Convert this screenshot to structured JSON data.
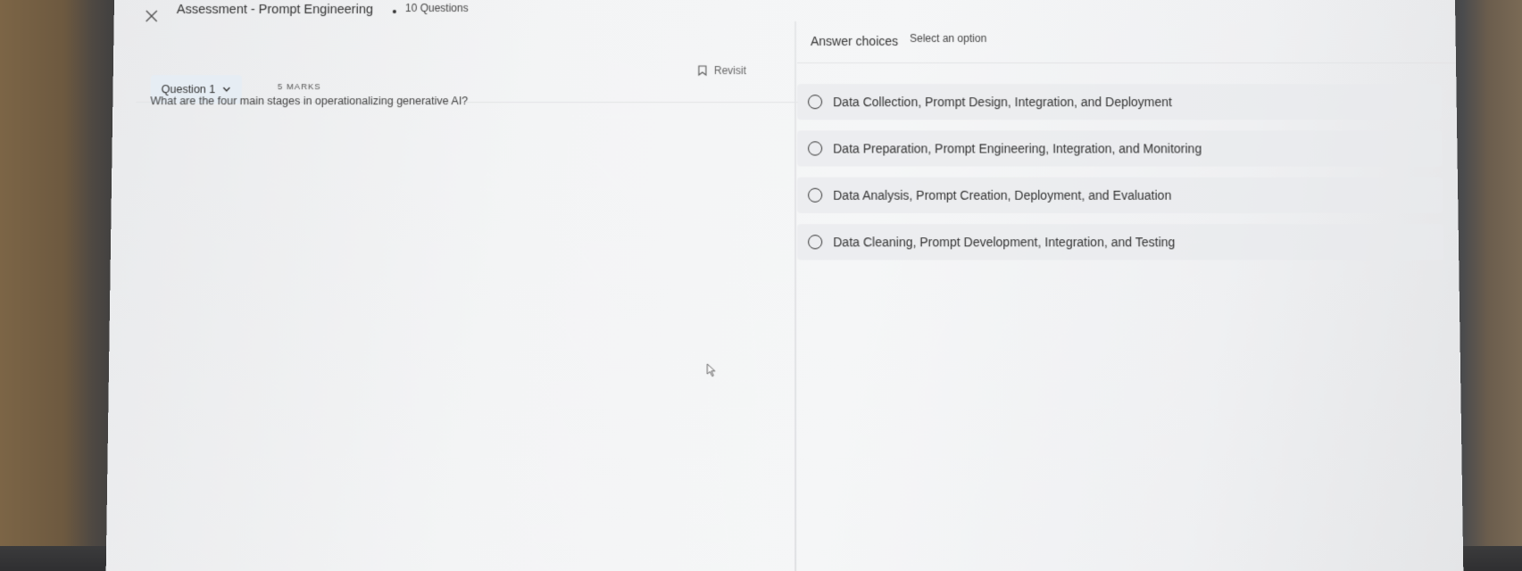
{
  "header": {
    "title": "Assessment - Prompt Engineering",
    "question_count": "10 Questions"
  },
  "question_panel": {
    "selector_label": "Question 1",
    "marks": "5 MARKS",
    "revisit_label": "Revisit",
    "question_text": "What are the four main stages in operationalizing generative AI?"
  },
  "answer_panel": {
    "title": "Answer choices",
    "hint": "Select an option",
    "options": [
      {
        "label": "Data Collection, Prompt Design, Integration, and Deployment",
        "selected": false
      },
      {
        "label": "Data Preparation, Prompt Engineering, Integration, and Monitoring",
        "selected": false
      },
      {
        "label": "Data Analysis, Prompt Creation, Deployment, and Evaluation",
        "selected": false
      },
      {
        "label": "Data Cleaning, Prompt Development, Integration, and Testing",
        "selected": false
      }
    ]
  },
  "icons": {
    "close": "close-icon",
    "chevron": "chevron-down-icon",
    "bookmark": "bookmark-icon",
    "cursor": "mouse-cursor-icon"
  }
}
